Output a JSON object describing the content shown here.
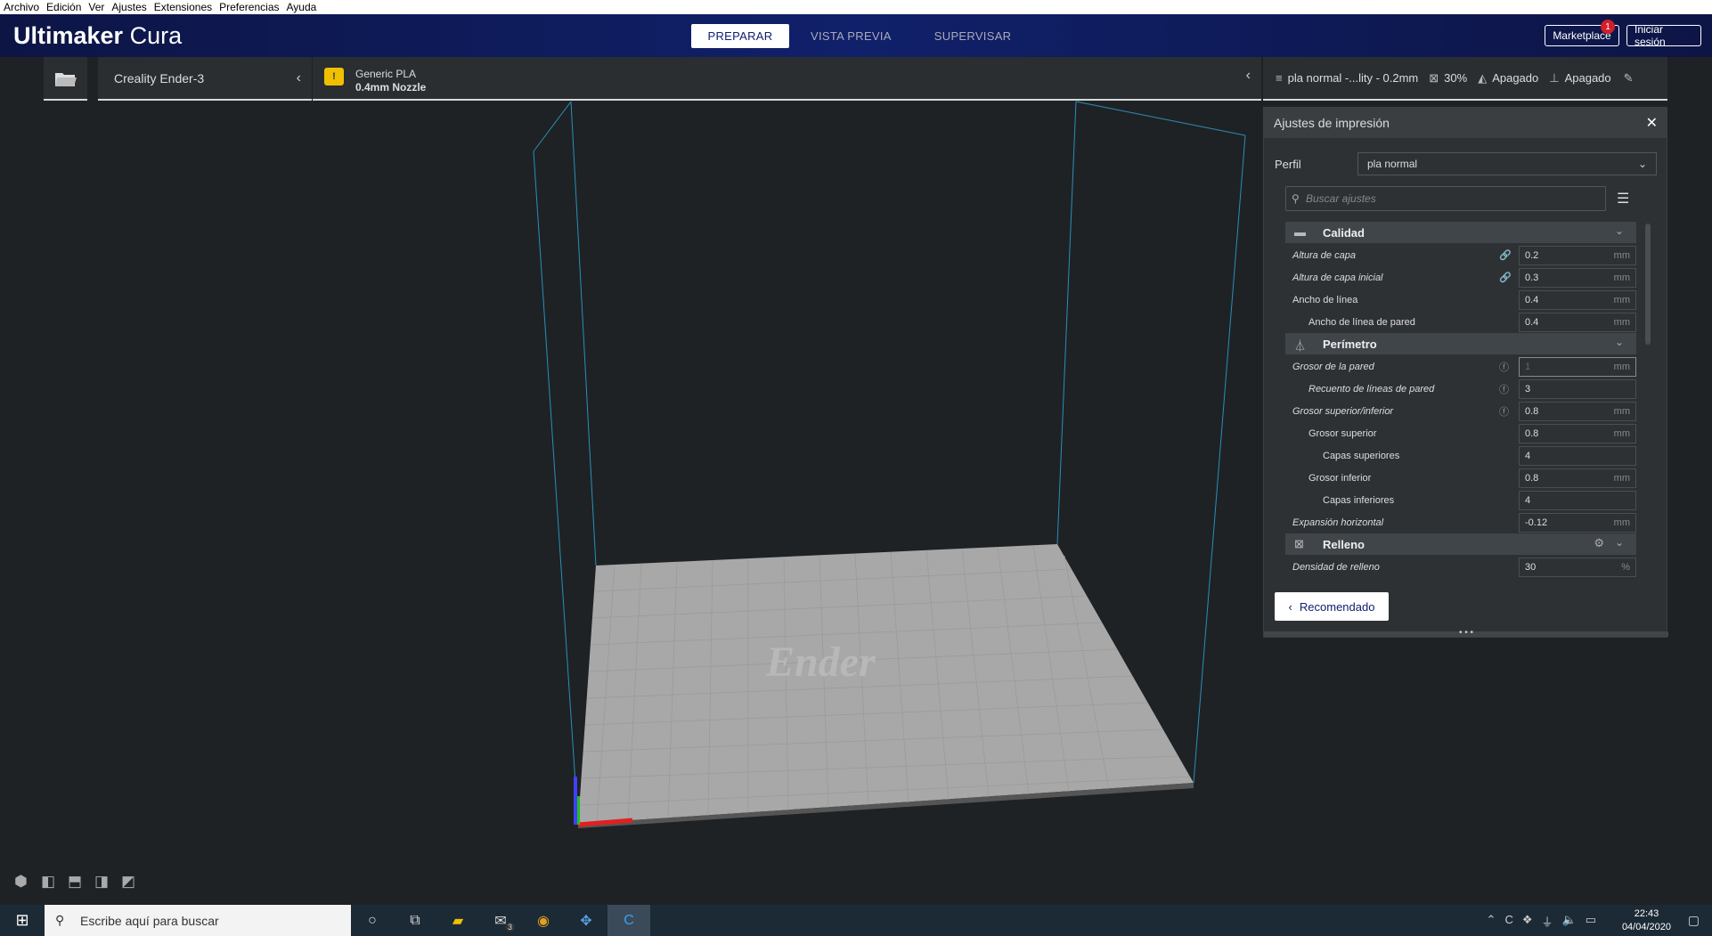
{
  "menu": [
    "Archivo",
    "Edición",
    "Ver",
    "Ajustes",
    "Extensiones",
    "Preferencias",
    "Ayuda"
  ],
  "app": {
    "brand": "Ultimaker",
    "product": "Cura"
  },
  "tabs": [
    {
      "label": "PREPARAR",
      "active": true
    },
    {
      "label": "VISTA PREVIA",
      "active": false
    },
    {
      "label": "SUPERVISAR",
      "active": false
    }
  ],
  "header": {
    "marketplace": "Marketplace",
    "marketplace_badge": "1",
    "login": "Iniciar sesión"
  },
  "stage": {
    "printer": "Creality Ender-3",
    "material_name": "Generic PLA",
    "nozzle": "0.4mm Nozzle"
  },
  "summary": {
    "profile": "pla normal -...lity - 0.2mm",
    "infill": "30%",
    "support": "Apagado",
    "adhesion": "Apagado"
  },
  "panel": {
    "title": "Ajustes de impresión",
    "profile_label": "Perfil",
    "profile_value": "pla normal",
    "search_placeholder": "Buscar ajustes",
    "recommended_button": "Recomendado"
  },
  "categories": {
    "quality": {
      "label": "Calidad",
      "settings": [
        {
          "label": "Altura de capa",
          "value": "0.2",
          "unit": "mm"
        },
        {
          "label": "Altura de capa inicial",
          "value": "0.3",
          "unit": "mm"
        },
        {
          "label": "Ancho de línea",
          "value": "0.4",
          "unit": "mm"
        },
        {
          "label": "Ancho de línea de pared",
          "value": "0.4",
          "unit": "mm"
        }
      ]
    },
    "perimeter": {
      "label": "Perímetro",
      "settings": [
        {
          "label": "Grosor de la pared",
          "value": "1",
          "unit": "mm"
        },
        {
          "label": "Recuento de líneas de pared",
          "value": "3",
          "unit": ""
        },
        {
          "label": "Grosor superior/inferior",
          "value": "0.8",
          "unit": "mm"
        },
        {
          "label": "Grosor superior",
          "value": "0.8",
          "unit": "mm"
        },
        {
          "label": "Capas superiores",
          "value": "4",
          "unit": ""
        },
        {
          "label": "Grosor inferior",
          "value": "0.8",
          "unit": "mm"
        },
        {
          "label": "Capas inferiores",
          "value": "4",
          "unit": ""
        },
        {
          "label": "Expansión horizontal",
          "value": "-0.12",
          "unit": "mm"
        }
      ]
    },
    "infill": {
      "label": "Relleno",
      "settings": [
        {
          "label": "Densidad de relleno",
          "value": "30",
          "unit": "%"
        }
      ]
    }
  },
  "build_plate_logo": "Ender",
  "taskbar": {
    "search": "Escribe aquí para buscar",
    "mail_badge": "3",
    "time": "22:43",
    "date": "04/04/2020"
  },
  "colors": {
    "header_bg": "#10206a",
    "accent_blue": "#102070",
    "material_yellow": "#f0c000",
    "axis_x": "#e02020",
    "axis_y": "#20c020",
    "axis_z": "#4040ff"
  }
}
